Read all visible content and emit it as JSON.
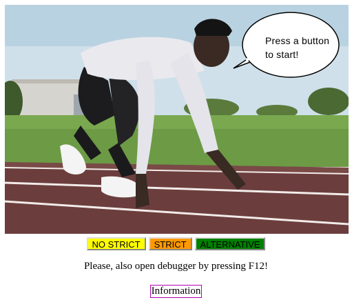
{
  "hero": {
    "speech_bubble": "Press a button to start!"
  },
  "buttons": {
    "no_strict": "NO STRICT",
    "strict": "STRICT",
    "alternative": "ALTERNATIVE"
  },
  "message": "Please, also open debugger by pressing F12!",
  "info_button": "Information",
  "colors": {
    "no_strict_bg": "#ffff00",
    "strict_bg": "#ff9900",
    "alternative_bg": "#008000",
    "info_border": "#b000b0"
  }
}
